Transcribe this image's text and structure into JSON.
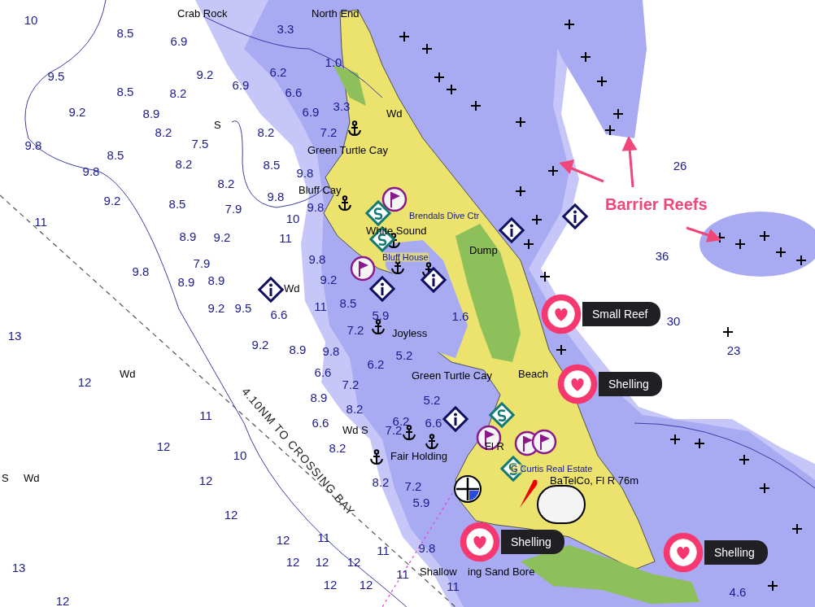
{
  "map": {
    "place_labels": [
      {
        "text": "Crab Rock",
        "kind": "place"
      },
      {
        "text": "North End",
        "kind": "place"
      },
      {
        "text": "Wd",
        "kind": "place"
      },
      {
        "text": "S",
        "kind": "place"
      },
      {
        "text": "Green Turtle Cay",
        "kind": "place"
      },
      {
        "text": "Bluff Cay",
        "kind": "place"
      },
      {
        "text": "Brendals Dive Ctr",
        "kind": "business"
      },
      {
        "text": "White Sound",
        "kind": "place"
      },
      {
        "text": "Bluff House",
        "kind": "business"
      },
      {
        "text": "Dump",
        "kind": "place"
      },
      {
        "text": "Wd",
        "kind": "place"
      },
      {
        "text": "Joyless",
        "kind": "place"
      },
      {
        "text": "Wd",
        "kind": "place"
      },
      {
        "text": "Green Turtle Cay",
        "kind": "place"
      },
      {
        "text": "Beach",
        "kind": "place"
      },
      {
        "text": "Wd S",
        "kind": "place"
      },
      {
        "text": "Fair Holding",
        "kind": "place"
      },
      {
        "text": "Fl R",
        "kind": "place"
      },
      {
        "text": "G Curtis Real Estate",
        "kind": "business"
      },
      {
        "text": "S",
        "kind": "place"
      },
      {
        "text": "Wd",
        "kind": "place"
      },
      {
        "text": "BaTelCo, Fl R 76m",
        "kind": "place"
      },
      {
        "text": "Shallow",
        "kind": "place"
      },
      {
        "text": "ing Sand Bore",
        "kind": "place"
      }
    ],
    "soundings": [
      "10",
      "8.5",
      "6.9",
      "3.3",
      "9.5",
      "9.2",
      "6.9",
      "6.2",
      "8.5",
      "8.2",
      "6.6",
      "9.2",
      "8.9",
      "6.9",
      "3.3",
      "1.0",
      "9.8",
      "8.2",
      "7.5",
      "8.2",
      "7.2",
      "8.5",
      "8.2",
      "8.5",
      "9.8",
      "9.8",
      "8.2",
      "9.2",
      "8.5",
      "7.9",
      "9.8",
      "11",
      "10",
      "9.8",
      "8.9",
      "9.2",
      "11",
      "9.8",
      "9.8",
      "7.9",
      "8.9",
      "8.9",
      "9.2",
      "6.6",
      "9.2",
      "9.5",
      "11",
      "8.5",
      "5.9",
      "7.2",
      "1.6",
      "13",
      "9.2",
      "8.9",
      "9.8",
      "6.2",
      "5.2",
      "12",
      "6.6",
      "7.2",
      "8.9",
      "8.2",
      "11",
      "6.6",
      "6.2",
      "5.2",
      "6.6",
      "7.2",
      "12",
      "10",
      "8.2",
      "8.2",
      "7.2",
      "5.9",
      "12",
      "12",
      "12",
      "11",
      "9.8",
      "12",
      "12",
      "12",
      "11",
      "13",
      "12",
      "12",
      "11",
      "11",
      "12",
      "4.6",
      "26",
      "36",
      "30",
      "23"
    ],
    "route_label": "4.10NM TO CROSSING BAY",
    "annotation": {
      "label": "Barrier Reefs"
    },
    "callouts": [
      {
        "label": "Small Reef"
      },
      {
        "label": "Shelling"
      },
      {
        "label": "Shelling"
      },
      {
        "label": "Shelling"
      }
    ]
  }
}
